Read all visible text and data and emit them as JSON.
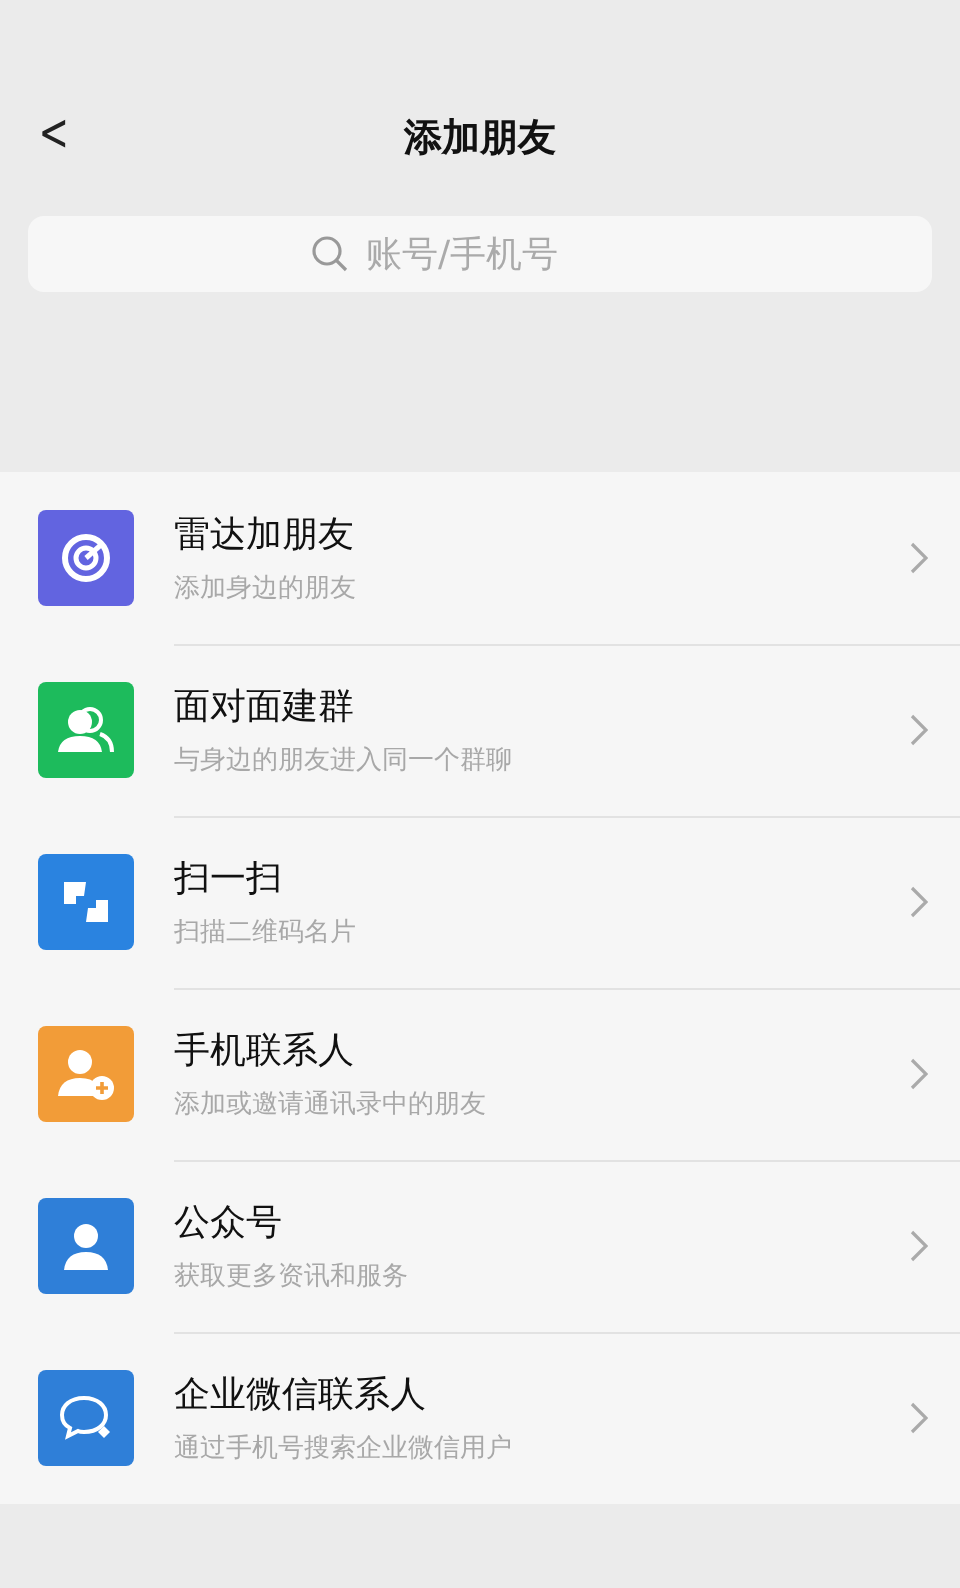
{
  "header": {
    "back": "<",
    "title": "添加朋友"
  },
  "search": {
    "placeholder": "账号/手机号"
  },
  "items": [
    {
      "kind": "radar",
      "color": "#6264e0",
      "title": "雷达加朋友",
      "subtitle": "添加身边的朋友"
    },
    {
      "kind": "group",
      "color": "#1dbb5c",
      "title": "面对面建群",
      "subtitle": "与身边的朋友进入同一个群聊"
    },
    {
      "kind": "scan",
      "color": "#2a83e0",
      "title": "扫一扫",
      "subtitle": "扫描二维码名片"
    },
    {
      "kind": "contact",
      "color": "#f29c38",
      "title": "手机联系人",
      "subtitle": "添加或邀请通讯录中的朋友"
    },
    {
      "kind": "official",
      "color": "#2f7fd8",
      "title": "公众号",
      "subtitle": "获取更多资讯和服务"
    },
    {
      "kind": "chat",
      "color": "#2f7fd8",
      "title": "企业微信联系人",
      "subtitle": "通过手机号搜索企业微信用户"
    }
  ]
}
